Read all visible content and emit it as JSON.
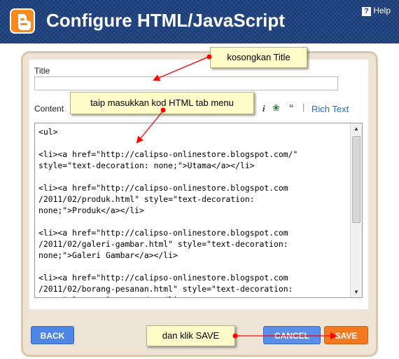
{
  "header": {
    "title": "Configure HTML/JavaScript",
    "help_label": "Help",
    "help_glyph": "?"
  },
  "form": {
    "title_label": "Title",
    "title_value": "",
    "content_label": "Content",
    "rich_text_label": "Rich Text",
    "content_lines": [
      "<ul>",
      "",
      "<li><a href=\"http://calipso-onlinestore.blogspot.com/\"",
      "style=\"text-decoration: none;\">Utama</a></li>",
      "",
      "<li><a href=\"http://calipso-onlinestore.blogspot.com",
      "/2011/02/produk.html\" style=\"text-decoration:",
      "none;\">Produk</a></li>",
      "",
      "<li><a href=\"http://calipso-onlinestore.blogspot.com",
      "/2011/02/galeri-gambar.html\" style=\"text-decoration:",
      "none;\">Galeri Gambar</a></li>",
      "",
      "<li><a href=\"http://calipso-onlinestore.blogspot.com",
      "/2011/02/borang-pesanan.html\" style=\"text-decoration:",
      "none;\">Borang Pesanan</a></li>"
    ]
  },
  "buttons": {
    "back": "BACK",
    "cancel": "CANCEL",
    "save": "SAVE"
  },
  "annotations": {
    "note1": "kosongkan Title",
    "note2": "taip masukkan kod HTML tab menu",
    "note3": "dan klik SAVE"
  },
  "colors": {
    "header_bg": "#1c3f7a",
    "logo": "#f58a1f",
    "save": "#f57a1f",
    "blue_button": "#4d86e4",
    "arrow": "#ff0000"
  }
}
